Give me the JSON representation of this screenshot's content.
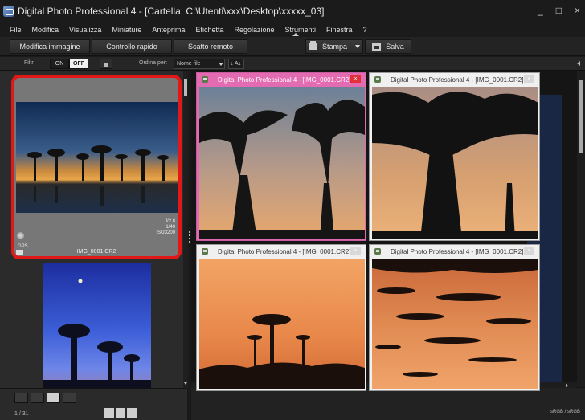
{
  "window": {
    "title": "Digital Photo Professional 4 - [Cartella: C:\\Utenti\\xxx\\Desktop\\xxxxx_03]",
    "controls": {
      "minimize": "_",
      "maximize": "□",
      "close": "×"
    }
  },
  "menu": [
    "File",
    "Modifica",
    "Visualizza",
    "Miniature",
    "Anteprima",
    "Etichetta",
    "Regolazione",
    "Strumenti",
    "Finestra",
    "?"
  ],
  "toolbar": {
    "edit_image": "Modifica immagine",
    "quick_check": "Controllo rapido",
    "remote_shoot": "Scatto remoto",
    "print": "Stampa",
    "save": "Salva"
  },
  "filterbar": {
    "filter_label": "Filtr",
    "on": "ON",
    "off": "OFF",
    "sort_label": "Ordina per:",
    "sort_value": "Nome file",
    "sort_dir": "↓ A↓"
  },
  "thumbnails": [
    {
      "name": "IMG_0001.CR2",
      "info": "f/2.8\n1/40\nISO3200",
      "gps": "GPS",
      "selected": true
    }
  ],
  "statusbar": {
    "count": "1 / 31",
    "color_space": "sRGB / sRGB"
  },
  "subwindows": [
    {
      "title": "Digital Photo Professional 4 - [IMG_0001.CR2]",
      "active": true
    },
    {
      "title": "Digital Photo Professional 4 - [IMG_0001.CR2]",
      "active": false
    },
    {
      "title": "Digital Photo Professional 4 - [IMG_0001.CR2]",
      "active": false
    },
    {
      "title": "Digital Photo Professional 4 - [IMG_0001.CR2]",
      "active": false
    }
  ],
  "colors": {
    "selection_border": "#e01818",
    "active_window": "#e26bb1",
    "close_button": "#e0313b"
  }
}
